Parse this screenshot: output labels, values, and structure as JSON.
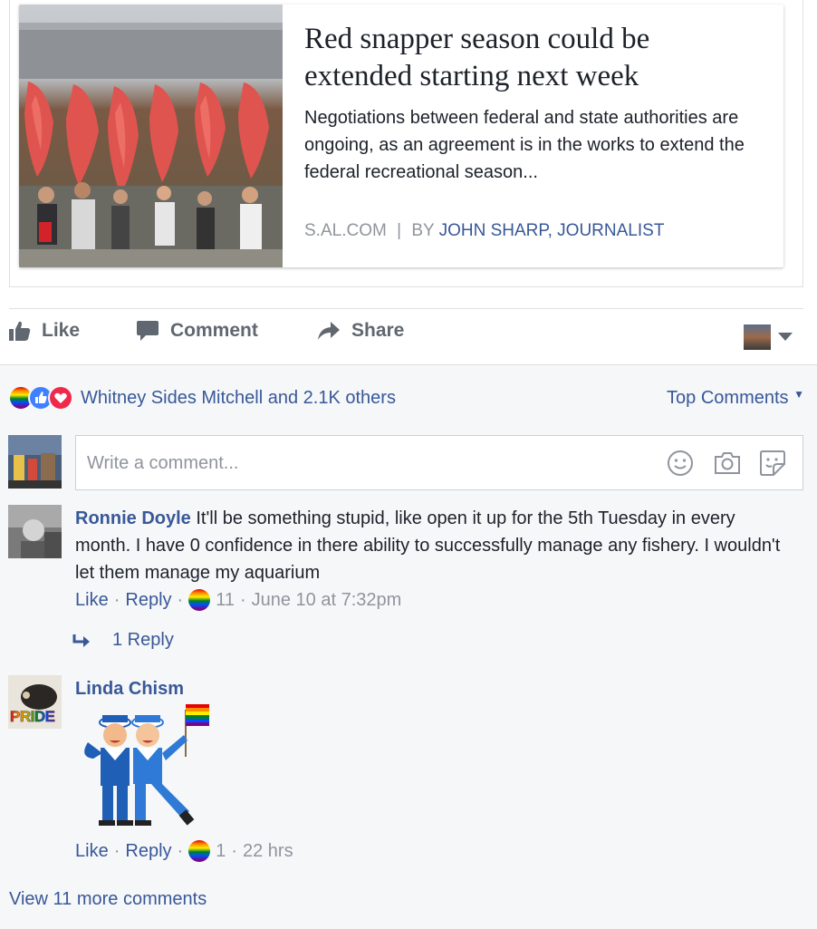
{
  "link_preview": {
    "title": "Red snapper season could be extended starting next week",
    "description": "Negotiations between federal and state authorities are ongoing, as an agreement is in the works to extend the federal recreational season...",
    "source": "S.AL.COM",
    "separator": "|",
    "by_prefix": "BY",
    "author": "JOHN SHARP, JOURNALIST"
  },
  "actions": {
    "like": "Like",
    "comment": "Comment",
    "share": "Share"
  },
  "reactions_summary": {
    "text": "Whitney Sides Mitchell and 2.1K others",
    "sort_label": "Top Comments"
  },
  "comment_input": {
    "placeholder": "Write a comment..."
  },
  "comments": [
    {
      "author": "Ronnie Doyle",
      "text": "It'll be something stupid, like open it up for the 5th Tuesday in every month. I have 0 confidence in there ability to successfully manage any fishery. I wouldn't let them manage my aquarium",
      "like_label": "Like",
      "reply_label": "Reply",
      "reaction_count": "11",
      "timestamp": "June 10 at 7:32pm",
      "replies_label": "1 Reply"
    },
    {
      "author": "Linda Chism",
      "avatar_text": "PRIDE",
      "like_label": "Like",
      "reply_label": "Reply",
      "reaction_count": "1",
      "timestamp": "22 hrs"
    }
  ],
  "view_more": "View 11 more comments",
  "colors": {
    "link_blue": "#385898",
    "muted_gray": "#90949c",
    "action_gray": "#606770",
    "comment_bg": "#f6f7f9",
    "like_blue": "#4080ff",
    "love_red": "#f0284a"
  }
}
